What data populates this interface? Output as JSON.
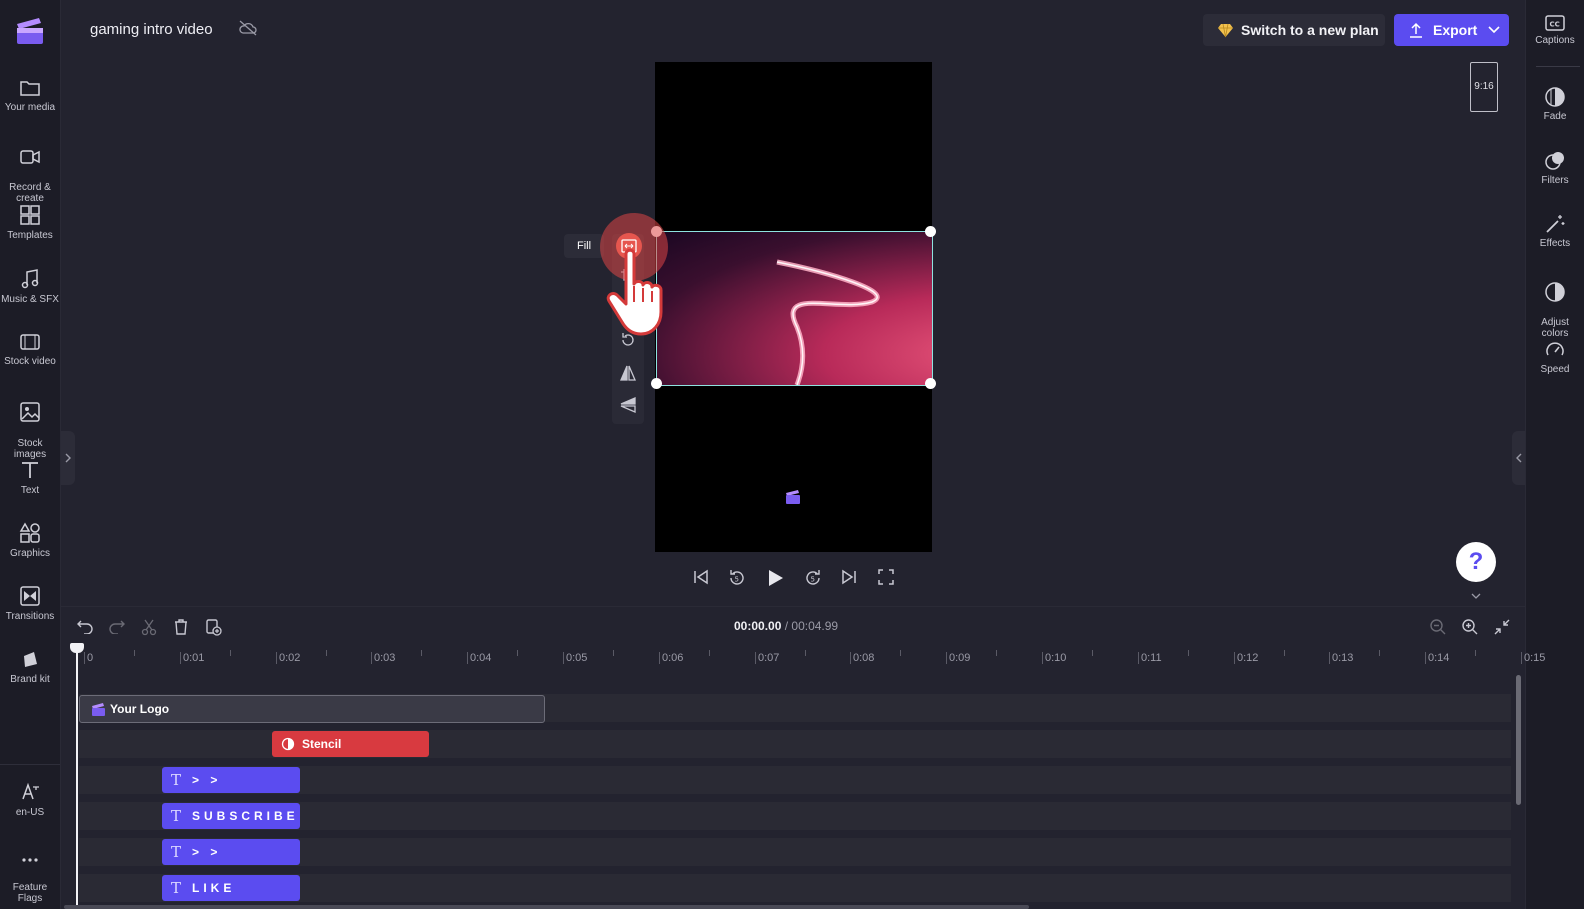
{
  "project": {
    "title": "gaming intro video"
  },
  "header": {
    "plan_label": "Switch to a new plan",
    "export_label": "Export"
  },
  "left_nav": [
    {
      "id": "your-media",
      "label": "Your media"
    },
    {
      "id": "record-create",
      "label": "Record &\ncreate"
    },
    {
      "id": "templates",
      "label": "Templates"
    },
    {
      "id": "music-sfx",
      "label": "Music & SFX"
    },
    {
      "id": "stock-video",
      "label": "Stock video"
    },
    {
      "id": "stock-images",
      "label": "Stock\nimages"
    },
    {
      "id": "text",
      "label": "Text"
    },
    {
      "id": "graphics",
      "label": "Graphics"
    },
    {
      "id": "transitions",
      "label": "Transitions"
    },
    {
      "id": "brand-kit",
      "label": "Brand kit"
    },
    {
      "id": "language",
      "label": "en-US"
    },
    {
      "id": "feature-flags",
      "label": "Feature\nFlags"
    }
  ],
  "right_nav": [
    {
      "id": "captions",
      "label": "Captions"
    },
    {
      "id": "fade",
      "label": "Fade"
    },
    {
      "id": "filters",
      "label": "Filters"
    },
    {
      "id": "effects",
      "label": "Effects"
    },
    {
      "id": "adjust-colors",
      "label": "Adjust\ncolors"
    },
    {
      "id": "speed",
      "label": "Speed"
    }
  ],
  "preview": {
    "aspect_ratio": "9:16",
    "tooltip": "Fill"
  },
  "timeline": {
    "current_time": "00:00.00",
    "separator": " / ",
    "total_time": "00:04.99",
    "ruler": [
      "0",
      "0:01",
      "0:02",
      "0:03",
      "0:04",
      "0:05",
      "0:06",
      "0:07",
      "0:08",
      "0:09",
      "0:10",
      "0:11",
      "0:12",
      "0:13",
      "0:14",
      "0:15"
    ],
    "clips": {
      "logo": "Your Logo",
      "stencil": "Stencil",
      "text1": "> >",
      "text2": "SUBSCRIBE",
      "text3": "> >",
      "text4": "LIKE"
    }
  },
  "colors": {
    "accent": "#5b4cf0",
    "stencil": "#d83a40",
    "clip_border": "#8ee3e0"
  }
}
